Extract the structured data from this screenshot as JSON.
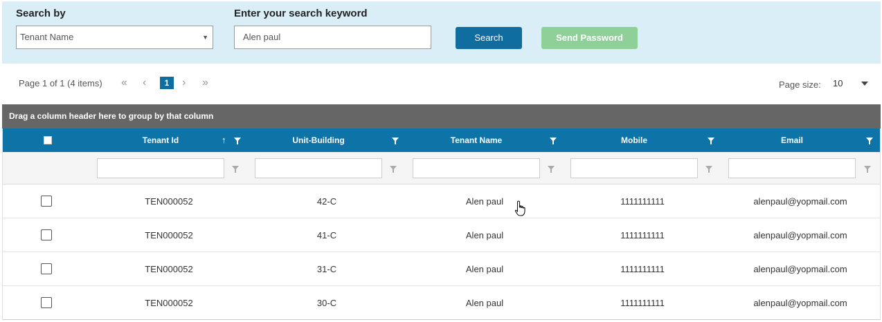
{
  "search": {
    "search_by_label": "Search by",
    "search_by_value": "Tenant Name",
    "keyword_label": "Enter your search keyword",
    "keyword_value": "Alen paul",
    "search_button": "Search",
    "send_password_button": "Send Password"
  },
  "pager": {
    "info": "Page 1 of 1 (4 items)",
    "current_page": "1",
    "page_size_label": "Page size:",
    "page_size_value": "10",
    "icons": [
      "first-page-icon",
      "prev-page-icon",
      "next-page-icon",
      "last-page-icon"
    ]
  },
  "group_bar": "Drag a column header here to group by that column",
  "columns": [
    "Tenant Id",
    "Unit-Building",
    "Tenant Name",
    "Mobile",
    "Email"
  ],
  "sort_indicator": "↑",
  "rows": [
    {
      "tenant_id": "TEN000052",
      "unit": "42-C",
      "name": "Alen paul",
      "mobile": "1111111111",
      "email": "alenpaul@yopmail.com"
    },
    {
      "tenant_id": "TEN000052",
      "unit": "41-C",
      "name": "Alen paul",
      "mobile": "1111111111",
      "email": "alenpaul@yopmail.com"
    },
    {
      "tenant_id": "TEN000052",
      "unit": "31-C",
      "name": "Alen paul",
      "mobile": "1111111111",
      "email": "alenpaul@yopmail.com"
    },
    {
      "tenant_id": "TEN000052",
      "unit": "30-C",
      "name": "Alen paul",
      "mobile": "1111111111",
      "email": "alenpaul@yopmail.com"
    }
  ],
  "colors": {
    "panel_bg": "#daeef8",
    "primary": "#0f6d9f",
    "send_button": "#8fcf98",
    "group_bar": "#666666",
    "header": "#0e73a7"
  }
}
